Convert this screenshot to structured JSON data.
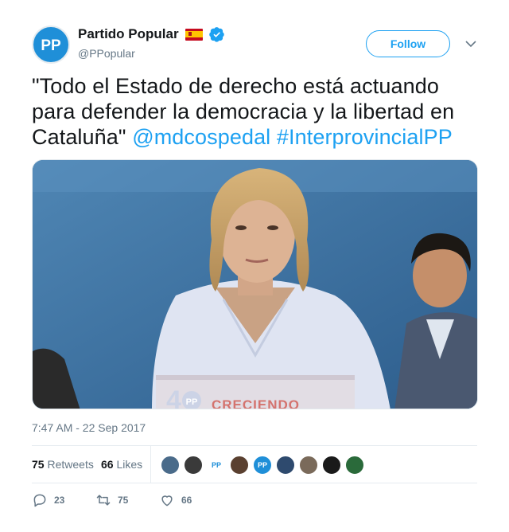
{
  "account": {
    "display_name": "Partido Popular",
    "handle": "@PPopular",
    "avatar_text": "PP",
    "flag": "spain-flag-icon",
    "verified": "verified-badge-icon"
  },
  "follow_button": {
    "label": "Follow"
  },
  "tweet": {
    "text": "\"Todo el Estado de derecho está actuando para defender la democracia y la libertad en Cataluña\"",
    "mention": "@mdcospedal",
    "hashtag": "#InterprovincialPP",
    "media": {
      "podium_text": "CRECIENDO",
      "podium_logo": "4",
      "podium_logo_mark": "PP"
    },
    "timestamp": "7:47 AM - 22 Sep 2017"
  },
  "stats": {
    "retweets_count": "75",
    "retweets_label": "Retweets",
    "likes_count": "66",
    "likes_label": "Likes"
  },
  "likers": {
    "avatars": [
      "liker-avatar-1",
      "liker-avatar-2",
      "liker-avatar-3",
      "liker-avatar-4",
      "liker-avatar-5",
      "liker-avatar-6",
      "liker-avatar-7",
      "liker-avatar-8",
      "liker-avatar-9"
    ],
    "avatar_colors": [
      "#4a6b8a",
      "#3a3a3a",
      "#ffffff",
      "#5a4030",
      "#1f8fd8",
      "#2e4a6e",
      "#7a6a5a",
      "#1a1a1a",
      "#2a6a3a"
    ],
    "pp_mark": "PP"
  },
  "actions": {
    "reply_count": "23",
    "retweet_count": "75",
    "like_count": "66"
  },
  "colors": {
    "accent": "#1da1f2",
    "text": "#14171a",
    "muted": "#657786",
    "border": "#e6ecf0"
  }
}
